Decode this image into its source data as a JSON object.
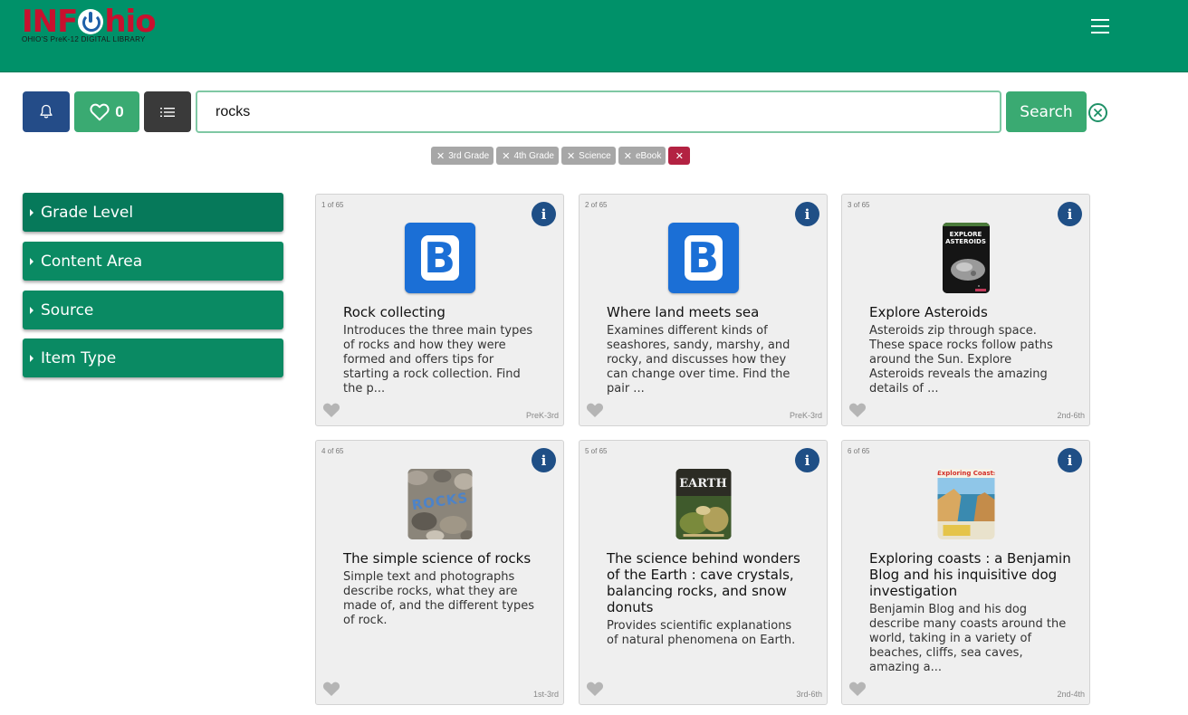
{
  "header": {
    "logo_word_left": "INF",
    "logo_word_right": "hio",
    "logo_tagline": "OHIO'S PreK-12 DIGITAL LIBRARY"
  },
  "toolbar": {
    "favorites_count": "0",
    "search_value": "rocks",
    "search_label": "Search"
  },
  "filters": [
    {
      "label": "3rd Grade"
    },
    {
      "label": "4th Grade"
    },
    {
      "label": "Science"
    },
    {
      "label": "eBook"
    }
  ],
  "facets": [
    {
      "label": "Grade Level"
    },
    {
      "label": "Content Area"
    },
    {
      "label": "Source"
    },
    {
      "label": "Item Type"
    }
  ],
  "results": [
    {
      "count": "1 of 65",
      "title": "Rock collecting",
      "description": "Introduces the three main types of rocks and how they were formed and offers tips for starting a rock collection. Find the p...",
      "grade": "PreK-3rd",
      "thumb": "b-app-icon"
    },
    {
      "count": "2 of 65",
      "title": "Where land meets sea",
      "description": "Examines different kinds of seashores, sandy, marshy, and rocky, and discusses how they can change over time. Find the pair ...",
      "grade": "PreK-3rd",
      "thumb": "b-app-icon"
    },
    {
      "count": "3 of 65",
      "title": "Explore Asteroids",
      "description": "Asteroids zip through space. These space rocks follow paths around the Sun. Explore Asteroids reveals the amazing details of ...",
      "grade": "2nd-6th",
      "thumb": "book-cover",
      "cover_text": "EXPLORE ASTEROIDS"
    },
    {
      "count": "4 of 65",
      "title": "The simple science of rocks",
      "description": "Simple text and photographs describe rocks, what they are made of, and the different types of rock.",
      "grade": "1st-3rd",
      "thumb": "book-cover",
      "cover_text": "ROCKS"
    },
    {
      "count": "5 of 65",
      "title": "The science behind wonders of the Earth : cave crystals, balancing rocks, and snow donuts",
      "description": "Provides scientific explanations of natural phenomena on Earth.",
      "grade": "3rd-6th",
      "thumb": "book-cover",
      "cover_text": "EARTH"
    },
    {
      "count": "6 of 65",
      "title": "Exploring coasts : a Benjamin Blog and his inquisitive dog investigation",
      "description": "Benjamin Blog and his dog describe many coasts around the world, taking in a variety of beaches, cliffs, sea caves, amazing a...",
      "grade": "2nd-4th",
      "thumb": "book-cover",
      "cover_text": "Exploring Coasts"
    }
  ],
  "colors": {
    "header_green": "#009169",
    "accent_green": "#3aaa72",
    "bell_blue": "#244c88",
    "chip_gray": "#a7a7a7",
    "clear_red": "#b32242",
    "info_blue": "#1f4f86"
  }
}
